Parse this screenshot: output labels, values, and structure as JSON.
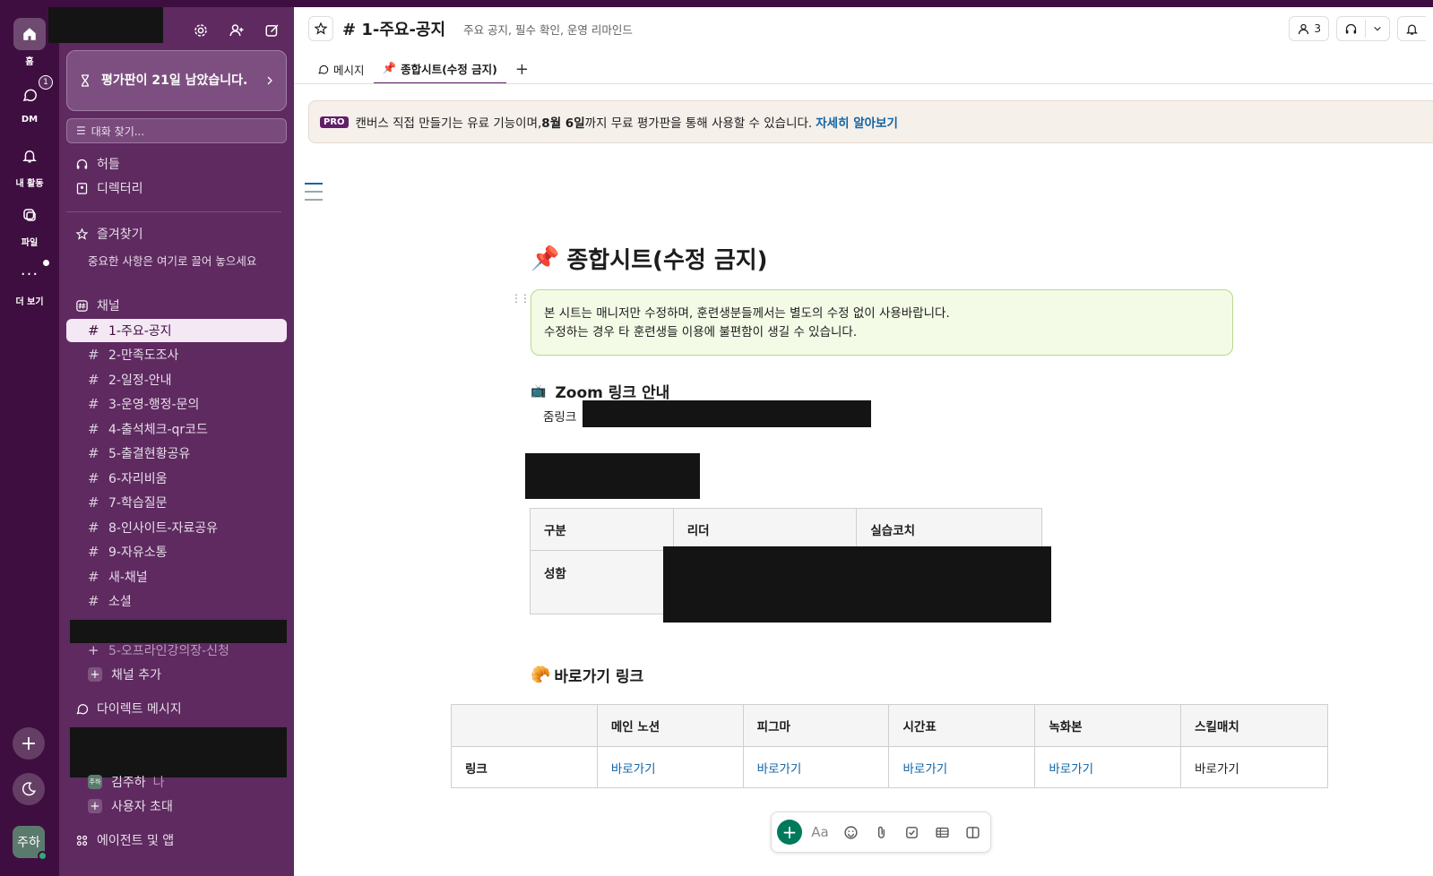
{
  "rail": {
    "home_label": "홈",
    "dm_label": "DM",
    "dm_badge": "1",
    "activity_label": "내 활동",
    "files_label": "파일",
    "more_label": "더 보기",
    "avatar_text": "주하"
  },
  "sidebar": {
    "trial_text": "평가판이 21일 남았습니다.",
    "search_placeholder": "대화 찾기...",
    "huddle": "허들",
    "directory": "디렉터리",
    "favorites": "즐겨찾기",
    "favorites_hint": "중요한 사항은 여기로 끌어 놓으세요",
    "channels_header": "채널",
    "channels": [
      "1-주요-공지",
      "2-만족도조사",
      "2-일정-안내",
      "3-운영-행정-문의",
      "4-출석체크-qr코드",
      "5-출결현황공유",
      "6-자리비움",
      "7-학습질문",
      "8-인사이트-자료공유",
      "9-자유소통",
      "새-채널",
      "소셜"
    ],
    "offline_channel": "5-오프라인강의장-신청",
    "add_channel": "채널 추가",
    "dm_header": "다이렉트 메시지",
    "dm_self": "김주하",
    "dm_self_tag": "나",
    "invite_user": "사용자 초대",
    "agents": "에이전트 및 앱"
  },
  "header": {
    "channel_name": "# 1-주요-공지",
    "description": "주요 공지, 필수 확인, 운영 리마인드",
    "member_count": "3"
  },
  "tabs": {
    "messages": "메시지",
    "canvas": "종합시트(수정 금지)",
    "canvas_emoji": "📌"
  },
  "banner": {
    "badge": "PRO",
    "text_before": "캔버스 직접 만들기는 유료 기능이며, ",
    "text_bold": "8월 6일",
    "text_after": "까지 무료 평가판을 통해 사용할 수 있습니다.",
    "link": "자세히 알아보기"
  },
  "doc": {
    "title_emoji": "📌",
    "title": "종합시트(수정 금지)",
    "callout_line1": "본 시트는 매니저만 수정하며, 훈련생분들께서는 별도의 수정 없이 사용바랍니다.",
    "callout_line2": "수정하는 경우 타 훈련생들 이용에 불편함이 생길 수 있습니다.",
    "zoom_emoji": "📺",
    "zoom_heading": "Zoom 링크 안내",
    "zoom_label": "줌링크",
    "staff_table": {
      "headers": [
        "구분",
        "리더",
        "실습코치"
      ],
      "row_label": "성함"
    },
    "shortcut_emoji": "🥐",
    "shortcut_heading": "바로가기 링크",
    "links_table": {
      "headers": [
        "",
        "메인 노션",
        "피그마",
        "시간표",
        "녹화본",
        "스킬매치"
      ],
      "row_label": "링크",
      "cells": [
        "바로가기",
        "바로가기",
        "바로가기",
        "바로가기",
        "바로가기"
      ]
    }
  },
  "toolbar": {
    "format_label": "Aa"
  }
}
